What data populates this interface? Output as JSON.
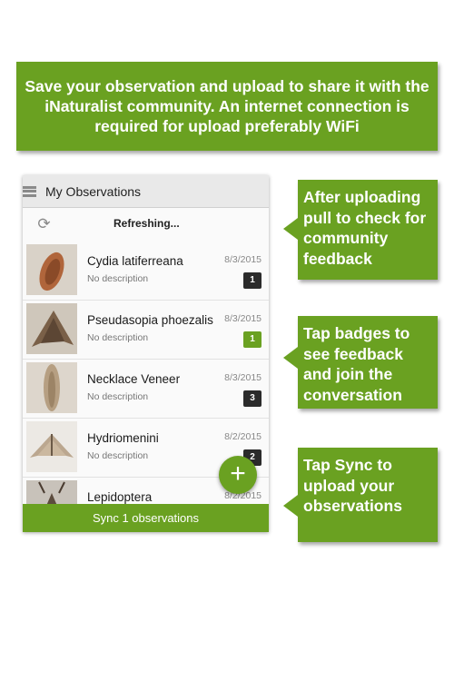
{
  "banner": {
    "text": "Save your observation and  upload to share it with the iNaturalist community. An internet connection is required for upload preferably WiFi"
  },
  "callouts": [
    {
      "text": "After uploading pull to check for community feedback"
    },
    {
      "text": "Tap badges to see feedback and join the conversation"
    },
    {
      "text": "Tap Sync to upload your observations"
    }
  ],
  "app": {
    "title": "My Observations",
    "refresh_text": "Refreshing...",
    "sync_label": "Sync 1 observations",
    "fab_label": "+",
    "menu_icon": "hamburger-menu-icon",
    "refresh_icon": "refresh-icon"
  },
  "observations": [
    {
      "name": "Cydia latiferreana",
      "desc": "No description",
      "date": "8/3/2015",
      "badge": "1",
      "badge_color": "#2b2b2b"
    },
    {
      "name": "Pseudasopia phoezalis",
      "desc": "No description",
      "date": "8/3/2015",
      "badge": "1",
      "badge_color": "#6aa121"
    },
    {
      "name": "Necklace Veneer",
      "desc": "No description",
      "date": "8/3/2015",
      "badge": "3",
      "badge_color": "#2b2b2b"
    },
    {
      "name": "Hydriomenini",
      "desc": "No description",
      "date": "8/2/2015",
      "badge": "2",
      "badge_color": "#2b2b2b"
    },
    {
      "name": "Lepidoptera",
      "desc": "",
      "date": "8/2/2015",
      "badge": "",
      "badge_color": ""
    }
  ],
  "colors": {
    "accent": "#6aa121",
    "badge_dark": "#2b2b2b"
  }
}
